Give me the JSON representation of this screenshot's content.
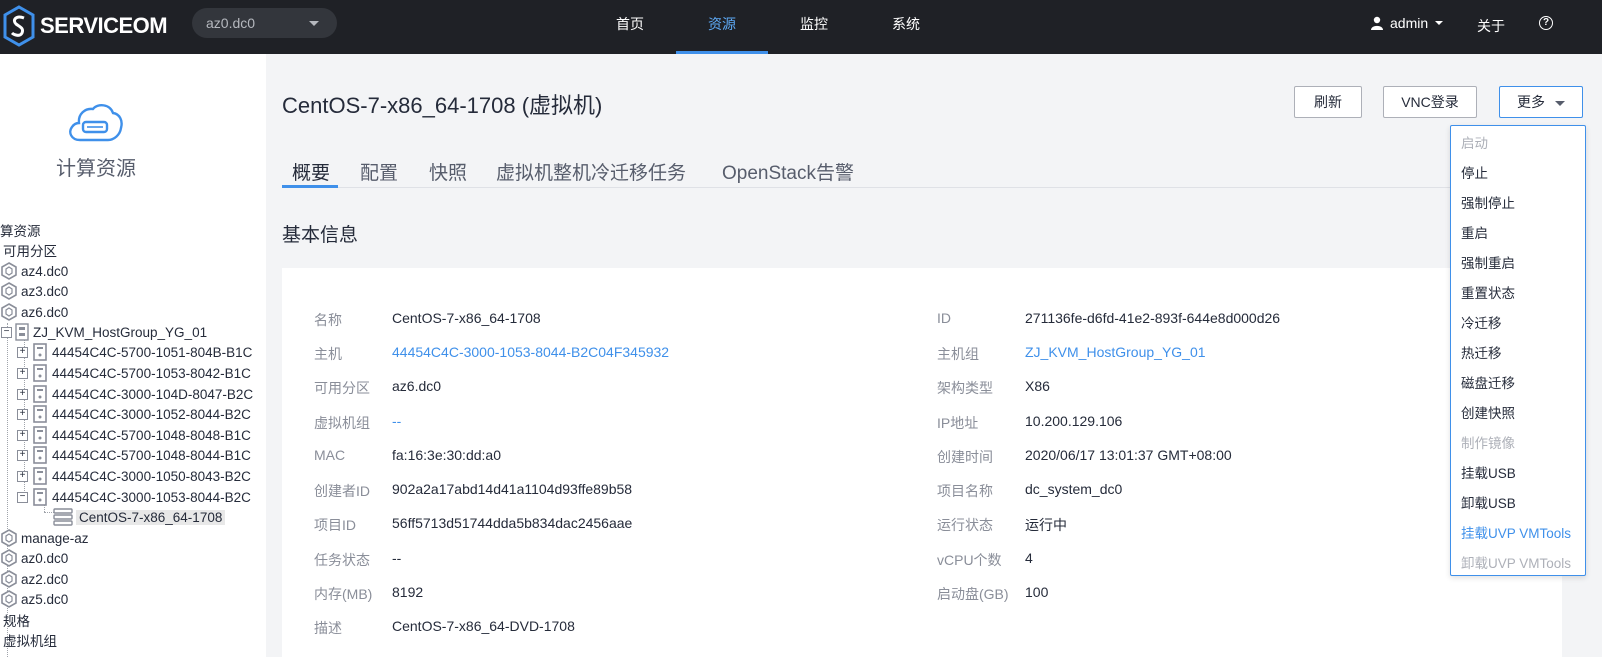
{
  "header": {
    "logo_text": "SERVICEOM",
    "region": "az0.dc0",
    "nav": [
      {
        "label": "首页"
      },
      {
        "label": "资源"
      },
      {
        "label": "监控"
      },
      {
        "label": "系统"
      }
    ],
    "active_nav": "资源",
    "user": "admin",
    "about": "关于",
    "help": "?"
  },
  "sidebar": {
    "title": "计算资源",
    "tree": [
      {
        "label": "算资源"
      },
      {
        "label": "可用分区"
      },
      {
        "label": "az4.dc0"
      },
      {
        "label": "az3.dc0"
      },
      {
        "label": "az6.dc0"
      },
      {
        "label": "ZJ_KVM_HostGroup_YG_01",
        "expander": "−"
      },
      {
        "label": "44454C4C-5700-1051-804B-B1C",
        "expander": "+"
      },
      {
        "label": "44454C4C-5700-1053-8042-B1C",
        "expander": "+"
      },
      {
        "label": "44454C4C-3000-104D-8047-B2C",
        "expander": "+"
      },
      {
        "label": "44454C4C-3000-1052-8044-B2C",
        "expander": "+"
      },
      {
        "label": "44454C4C-5700-1048-8048-B1C",
        "expander": "+"
      },
      {
        "label": "44454C4C-5700-1048-8044-B1C",
        "expander": "+"
      },
      {
        "label": "44454C4C-3000-1050-8043-B2C",
        "expander": "+"
      },
      {
        "label": "44454C4C-3000-1053-8044-B2C",
        "expander": "−"
      },
      {
        "label": "CentOS-7-x86_64-1708",
        "selected": true
      },
      {
        "label": "manage-az"
      },
      {
        "label": "az0.dc0"
      },
      {
        "label": "az2.dc0"
      },
      {
        "label": "az5.dc0"
      },
      {
        "label": "规格"
      },
      {
        "label": "虚拟机组"
      }
    ]
  },
  "main": {
    "title": "CentOS-7-x86_64-1708 (虚拟机)",
    "buttons": {
      "refresh": "刷新",
      "vnc": "VNC登录",
      "more": "更多"
    },
    "tabs": [
      {
        "label": "概要"
      },
      {
        "label": "配置"
      },
      {
        "label": "快照"
      },
      {
        "label": "虚拟机整机冷迁移任务"
      },
      {
        "label": "OpenStack告警"
      }
    ],
    "active_tab": "概要",
    "section_title": "基本信息",
    "left_fields": [
      {
        "key": "名称",
        "value": "CentOS-7-x86_64-1708"
      },
      {
        "key": "主机",
        "value": "44454C4C-3000-1053-8044-B2C04F345932",
        "link": true
      },
      {
        "key": "可用分区",
        "value": "az6.dc0"
      },
      {
        "key": "虚拟机组",
        "value": "--",
        "link": true
      },
      {
        "key": "MAC",
        "value": "fa:16:3e:30:dd:a0"
      },
      {
        "key": "创建者ID",
        "value": "902a2a17abd14d41a1104d93ffe89b58"
      },
      {
        "key": "项目ID",
        "value": "56ff5713d51744dda5b834dac2456aae"
      },
      {
        "key": "任务状态",
        "value": "--"
      },
      {
        "key": "内存(MB)",
        "value": "8192"
      },
      {
        "key": "描述",
        "value": "CentOS-7-x86_64-DVD-1708"
      }
    ],
    "right_fields": [
      {
        "key": "ID",
        "value": "271136fe-d6fd-41e2-893f-644e8d000d26"
      },
      {
        "key": "主机组",
        "value": "ZJ_KVM_HostGroup_YG_01",
        "link": true
      },
      {
        "key": "架构类型",
        "value": "X86"
      },
      {
        "key": "IP地址",
        "value": "10.200.129.106"
      },
      {
        "key": "创建时间",
        "value": "2020/06/17 13:01:37 GMT+08:00"
      },
      {
        "key": "项目名称",
        "value": "dc_system_dc0"
      },
      {
        "key": "运行状态",
        "value": "运行中"
      },
      {
        "key": "vCPU个数",
        "value": "4"
      },
      {
        "key": "启动盘(GB)",
        "value": "100"
      }
    ]
  },
  "more_menu": {
    "items": [
      {
        "label": "启动",
        "state": "disabled"
      },
      {
        "label": "停止",
        "state": "enabled"
      },
      {
        "label": "强制停止",
        "state": "enabled"
      },
      {
        "label": "重启",
        "state": "enabled"
      },
      {
        "label": "强制重启",
        "state": "enabled"
      },
      {
        "label": "重置状态",
        "state": "enabled"
      },
      {
        "label": "冷迁移",
        "state": "enabled"
      },
      {
        "label": "热迁移",
        "state": "enabled"
      },
      {
        "label": "磁盘迁移",
        "state": "enabled"
      },
      {
        "label": "创建快照",
        "state": "enabled"
      },
      {
        "label": "制作镜像",
        "state": "disabled"
      },
      {
        "label": "挂载USB",
        "state": "enabled"
      },
      {
        "label": "卸载USB",
        "state": "enabled"
      },
      {
        "label": "挂载UVP VMTools",
        "state": "hover"
      },
      {
        "label": "卸载UVP VMTools",
        "state": "disabled"
      }
    ]
  },
  "colors": {
    "topbar": "#1f2126",
    "accent": "#3f90ea",
    "link": "#3f90ea",
    "muted": "#8a8e99"
  }
}
